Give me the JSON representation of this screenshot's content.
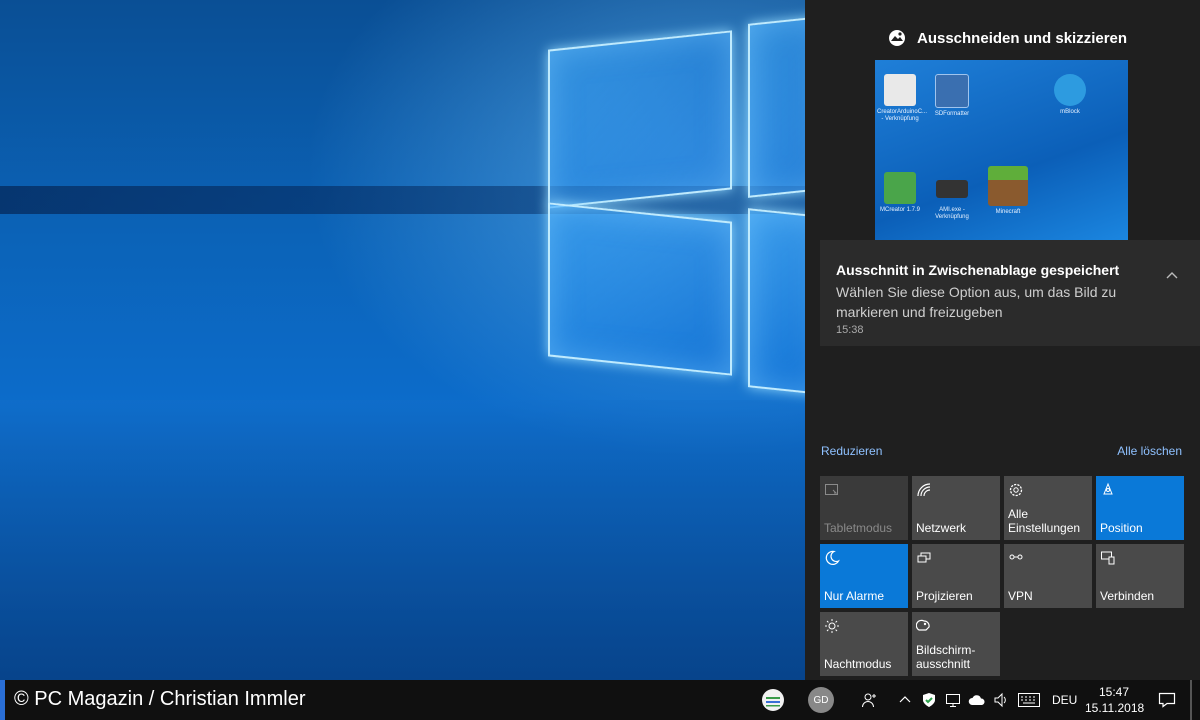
{
  "watermark": {
    "copyright": "© PC Magazin / Christian Immler"
  },
  "action_center": {
    "snip_title": "Ausschneiden und skizzieren",
    "thumbnail_icons": [
      {
        "label": "CreatorArduinoC... - Verknüpfung"
      },
      {
        "label": "SDFormatter"
      },
      {
        "label": "mBlock"
      },
      {
        "label": "MCreator 1.7.9"
      },
      {
        "label": "AMI.exe - Verknüpfung"
      },
      {
        "label": "Minecraft"
      }
    ],
    "toast": {
      "title": "Ausschnitt in Zwischenablage gespeichert",
      "body": "Wählen Sie diese Option aus, um das Bild zu markieren und freizugeben",
      "time": "15:38"
    },
    "collapse_label": "Reduzieren",
    "clear_all_label": "Alle löschen",
    "tiles": [
      {
        "label": "Tabletmodus",
        "state": "disabled",
        "icon": "tablet-icon"
      },
      {
        "label": "Netzwerk",
        "state": "off",
        "icon": "network-icon"
      },
      {
        "label": "Alle Einstellungen",
        "state": "off",
        "icon": "gear-icon"
      },
      {
        "label": "Position",
        "state": "on",
        "icon": "location-icon"
      },
      {
        "label": "Nur Alarme",
        "state": "on",
        "icon": "moon-icon"
      },
      {
        "label": "Projizieren",
        "state": "off",
        "icon": "project-icon"
      },
      {
        "label": "VPN",
        "state": "off",
        "icon": "vpn-icon"
      },
      {
        "label": "Verbinden",
        "state": "off",
        "icon": "connect-icon"
      },
      {
        "label": "Nachtmodus",
        "state": "off",
        "icon": "sun-icon"
      },
      {
        "label": "Bildschirm-ausschnitt",
        "state": "off",
        "icon": "snip-icon"
      }
    ]
  },
  "taskbar": {
    "avatar_initials": "GD",
    "language": "DEU",
    "time": "15:47",
    "date": "15.11.2018"
  },
  "colors": {
    "accent": "#0a79d8",
    "panel": "#1f1f1f",
    "tile": "#4a4a4a",
    "link": "#8fc1ff"
  }
}
